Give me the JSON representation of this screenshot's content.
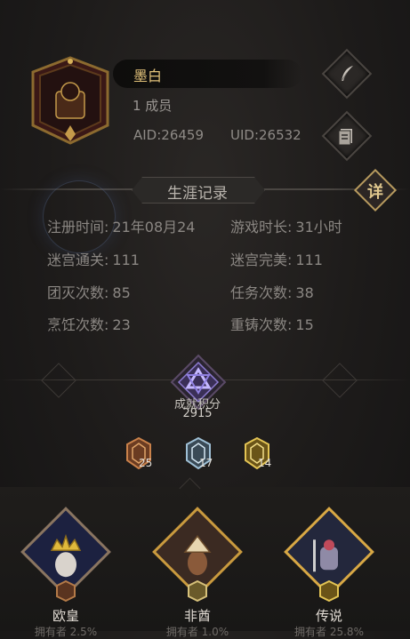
{
  "guild": {
    "name": "墨白",
    "members": "1 成员",
    "aid": "AID:26459",
    "uid": "UID:26532"
  },
  "section": {
    "title": "生涯记录",
    "detail_button": "详"
  },
  "stats": [
    {
      "label": "注册时间:",
      "value": "21年08月24"
    },
    {
      "label": "游戏时长:",
      "value": "31小时"
    },
    {
      "label": "迷宫通关:",
      "value": "111"
    },
    {
      "label": "迷宫完美:",
      "value": "111"
    },
    {
      "label": "团灭次数:",
      "value": "85"
    },
    {
      "label": "任务次数:",
      "value": "38"
    },
    {
      "label": "烹饪次数:",
      "value": "23"
    },
    {
      "label": "重铸次数:",
      "value": "15"
    }
  ],
  "achievement": {
    "label": "成就积分",
    "score": "2915",
    "medals": [
      {
        "tier": "bronze",
        "count": "25",
        "color": "#c9814a"
      },
      {
        "tier": "silver",
        "count": "17",
        "color": "#9fc0d6"
      },
      {
        "tier": "gold",
        "count": "14",
        "color": "#e3c454"
      }
    ]
  },
  "cards": [
    {
      "name": "欧皇",
      "sub": "拥有者 2.5%",
      "accent": "#c8a14e"
    },
    {
      "name": "非酋",
      "sub": "拥有者 1.0%",
      "accent": "#d4a347"
    },
    {
      "name": "传说",
      "sub": "拥有者 25.8%",
      "accent": "#e0b24a"
    }
  ],
  "icons": {
    "edit": "quill-icon",
    "document": "document-icon",
    "achievement": "triangle-emblem-icon"
  }
}
